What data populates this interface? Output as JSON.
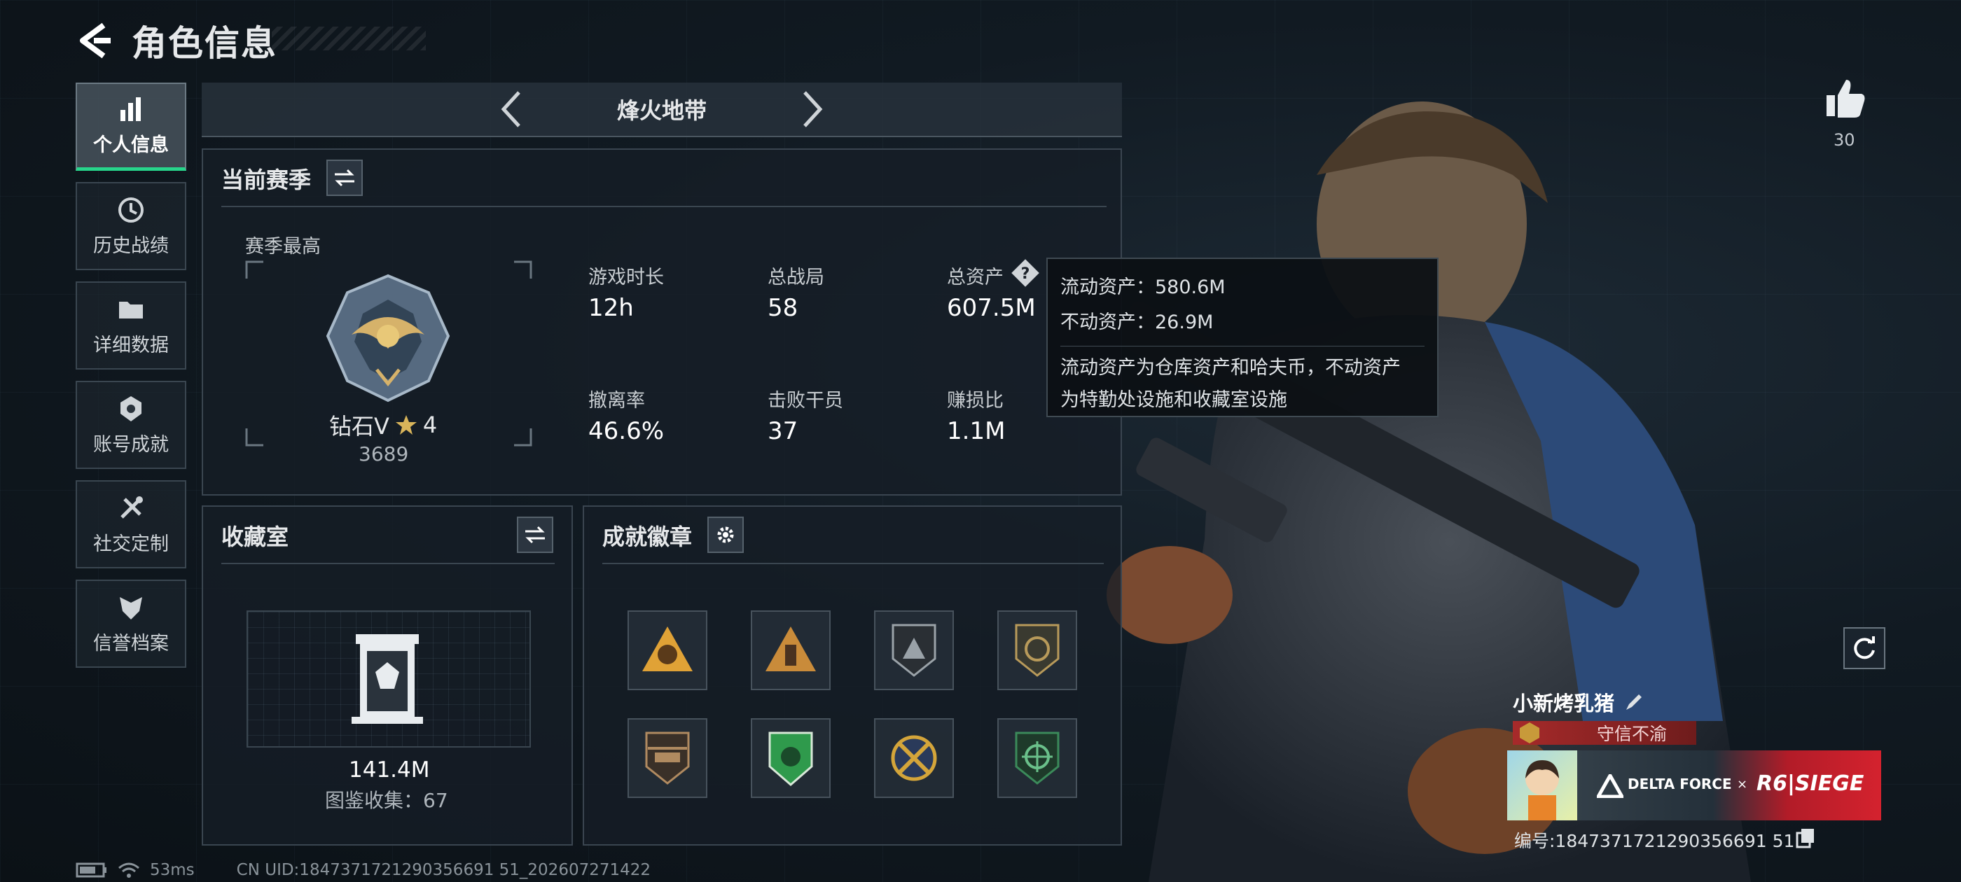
{
  "header": {
    "title": "角色信息"
  },
  "nav": {
    "items": [
      {
        "label": "个人信息",
        "icon": "bar-chart-icon",
        "active": true
      },
      {
        "label": "历史战绩",
        "icon": "history-clock-icon"
      },
      {
        "label": "详细数据",
        "icon": "folder-icon"
      },
      {
        "label": "账号成就",
        "icon": "achievement-icon"
      },
      {
        "label": "社交定制",
        "icon": "tools-icon"
      },
      {
        "label": "信誉档案",
        "icon": "shield-icon"
      }
    ]
  },
  "mode": {
    "name": "烽火地带"
  },
  "season": {
    "title": "当前赛季",
    "highest_label": "赛季最高",
    "rank_name": "钻石V",
    "rank_stars": "4",
    "rank_score": "3689",
    "stats": [
      {
        "label": "游戏时长",
        "value": "12h"
      },
      {
        "label": "总战局",
        "value": "58"
      },
      {
        "label": "总资产",
        "value": "607.5M"
      },
      {
        "label": "撤离率",
        "value": "46.6%"
      },
      {
        "label": "击败干员",
        "value": "37"
      },
      {
        "label": "赚损比",
        "value": "1.1M"
      }
    ]
  },
  "tooltip": {
    "liquid": "流动资产：580.6M",
    "fixed": "不动资产：26.9M",
    "desc_line1": "流动资产为仓库资产和哈夫币，不动资产",
    "desc_line2": "为特勤处设施和收藏室设施"
  },
  "collection": {
    "title": "收藏室",
    "value": "141.4M",
    "count": "图鉴收集：67"
  },
  "badges": {
    "title": "成就徽章",
    "items": [
      {
        "icon": "helmet-badge-icon",
        "color": "#e0a236"
      },
      {
        "icon": "soldier-badge-icon",
        "color": "#c98b3a"
      },
      {
        "icon": "triangle-badge-icon",
        "color": "#9aa2a8"
      },
      {
        "icon": "target-shield-icon",
        "color": "#b89a5a"
      },
      {
        "icon": "helicopter-badge-icon",
        "color": "#b08a60"
      },
      {
        "icon": "green-shield-icon",
        "color": "#2f9a4c"
      },
      {
        "icon": "gold-crossed-icon",
        "color": "#d4a53a"
      },
      {
        "icon": "green-target-icon",
        "color": "#3b8a5a"
      }
    ]
  },
  "right": {
    "likes": "30",
    "player_name": "小新烤乳猪",
    "honor_title": "守信不渝",
    "banner_left": "DELTA FORCE",
    "banner_x": "×",
    "banner_right": "R6|SIEGE",
    "uid": "编号:1847371721290356691 51"
  },
  "status_bar": {
    "ping": "53ms",
    "uid": "CN UID:1847371721290356691 51_202607271422"
  },
  "colors": {
    "accent_green": "#27d58b",
    "panel_bg": "#161e26",
    "tag_red": "#a72a2a"
  }
}
